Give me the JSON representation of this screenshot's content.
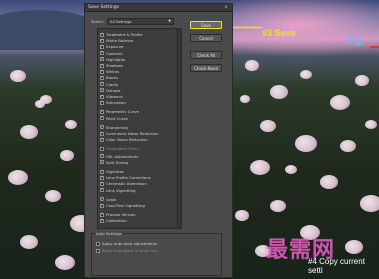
{
  "annotations": {
    "number1": "#1",
    "save_note": "#3 Save",
    "copy_note": "#4 Copy current setti",
    "watermark": "最需网",
    "colors": {
      "highlight": "#f2e31c",
      "number": "#5ec0ff",
      "watermark": "#e25ac2"
    }
  },
  "dialog": {
    "title": "Save Settings",
    "close": "×",
    "select_label": "Select:",
    "select_value": "All Settings",
    "buttons": {
      "save": "Save",
      "cancel": "Cancel",
      "check_all": "Check All",
      "check_none": "Check None"
    },
    "items": [
      {
        "label": "Treatment & Profile",
        "checked": true
      },
      {
        "label": "White Balance",
        "checked": true
      },
      {
        "label": "Exposure",
        "checked": true
      },
      {
        "label": "Contrast",
        "checked": true
      },
      {
        "label": "Highlights",
        "checked": true
      },
      {
        "label": "Shadows",
        "checked": true
      },
      {
        "label": "Whites",
        "checked": true
      },
      {
        "label": "Blacks",
        "checked": true
      },
      {
        "label": "Clarity",
        "checked": true
      },
      {
        "label": "Dehaze",
        "checked": true
      },
      {
        "label": "Vibrance",
        "checked": true
      },
      {
        "label": "Saturation",
        "checked": true
      },
      {
        "label": "Parametric Curve",
        "checked": true
      },
      {
        "label": "Point Curve",
        "checked": true
      },
      {
        "label": "Sharpening",
        "checked": true
      },
      {
        "label": "Luminance Noise Reduction",
        "checked": true
      },
      {
        "label": "Color Noise Reduction",
        "checked": true
      },
      {
        "label": "Graduated Filters",
        "checked": false,
        "dim": true
      },
      {
        "label": "HSL Adjustments",
        "checked": true
      },
      {
        "label": "Split Toning",
        "checked": true
      },
      {
        "label": "Vignettes",
        "checked": true
      },
      {
        "label": "Lens Profile Corrections",
        "checked": true
      },
      {
        "label": "Chromatic Aberration",
        "checked": true
      },
      {
        "label": "Lens Vignetting",
        "checked": true
      },
      {
        "label": "Grain",
        "checked": true
      },
      {
        "label": "Crop Post Vignetting",
        "checked": true
      },
      {
        "label": "Process Version",
        "checked": true
      },
      {
        "label": "Calibration",
        "checked": true
      }
    ],
    "settings": {
      "legend": "Auto Settings",
      "apply_auto": "Apply auto tone adjustments",
      "apply_auto_bw": "Apply auto black & white mix"
    }
  }
}
